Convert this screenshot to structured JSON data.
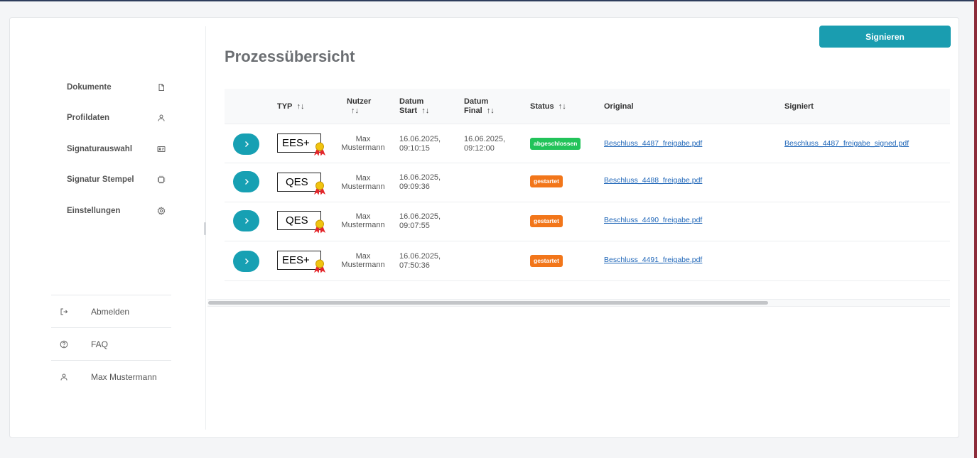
{
  "sidebar": {
    "items": [
      {
        "label": "Dokumente",
        "icon": "document-icon"
      },
      {
        "label": "Profildaten",
        "icon": "user-icon"
      },
      {
        "label": "Signaturauswahl",
        "icon": "id-card-icon"
      },
      {
        "label": "Signatur Stempel",
        "icon": "stamp-icon"
      },
      {
        "label": "Einstellungen",
        "icon": "gear-icon"
      }
    ],
    "footer": [
      {
        "label": "Abmelden",
        "icon": "logout-icon"
      },
      {
        "label": "FAQ",
        "icon": "help-icon"
      },
      {
        "label": "Max Mustermann",
        "icon": "user-icon"
      }
    ]
  },
  "main": {
    "title": "Prozessübersicht",
    "sign_button": "Signieren",
    "sort_glyph": "↑↓",
    "columns": {
      "typ": "TYP",
      "nutzer": "Nutzer",
      "datum_start_1": "Datum",
      "datum_start_2": "Start",
      "datum_final_1": "Datum",
      "datum_final_2": "Final",
      "status": "Status",
      "original": "Original",
      "signiert": "Signiert"
    },
    "rows": [
      {
        "typ": "EES+",
        "user_first": "Max",
        "user_last": "Mustermann",
        "start_date": "16.06.2025,",
        "start_time": "09:10:15",
        "final_date": "16.06.2025,",
        "final_time": "09:12:00",
        "status": "abgeschlossen",
        "status_kind": "done",
        "original": "Beschluss_4487_freigabe.pdf",
        "signed": "Beschluss_4487_freigabe_signed.pdf"
      },
      {
        "typ": "QES",
        "user_first": "Max",
        "user_last": "Mustermann",
        "start_date": "16.06.2025,",
        "start_time": "09:09:36",
        "final_date": "",
        "final_time": "",
        "status": "gestartet",
        "status_kind": "started",
        "original": "Beschluss_4488_freigabe.pdf",
        "signed": ""
      },
      {
        "typ": "QES",
        "user_first": "Max",
        "user_last": "Mustermann",
        "start_date": "16.06.2025,",
        "start_time": "09:07:55",
        "final_date": "",
        "final_time": "",
        "status": "gestartet",
        "status_kind": "started",
        "original": "Beschluss_4490_freigabe.pdf",
        "signed": ""
      },
      {
        "typ": "EES+",
        "user_first": "Max",
        "user_last": "Mustermann",
        "start_date": "16.06.2025,",
        "start_time": "07:50:36",
        "final_date": "",
        "final_time": "",
        "status": "gestartet",
        "status_kind": "started",
        "original": "Beschluss_4491_freigabe.pdf",
        "signed": ""
      }
    ]
  },
  "colors": {
    "accent": "#1a9db0",
    "status_done": "#22c35a",
    "status_started": "#f2761a",
    "link": "#1f66b8"
  }
}
